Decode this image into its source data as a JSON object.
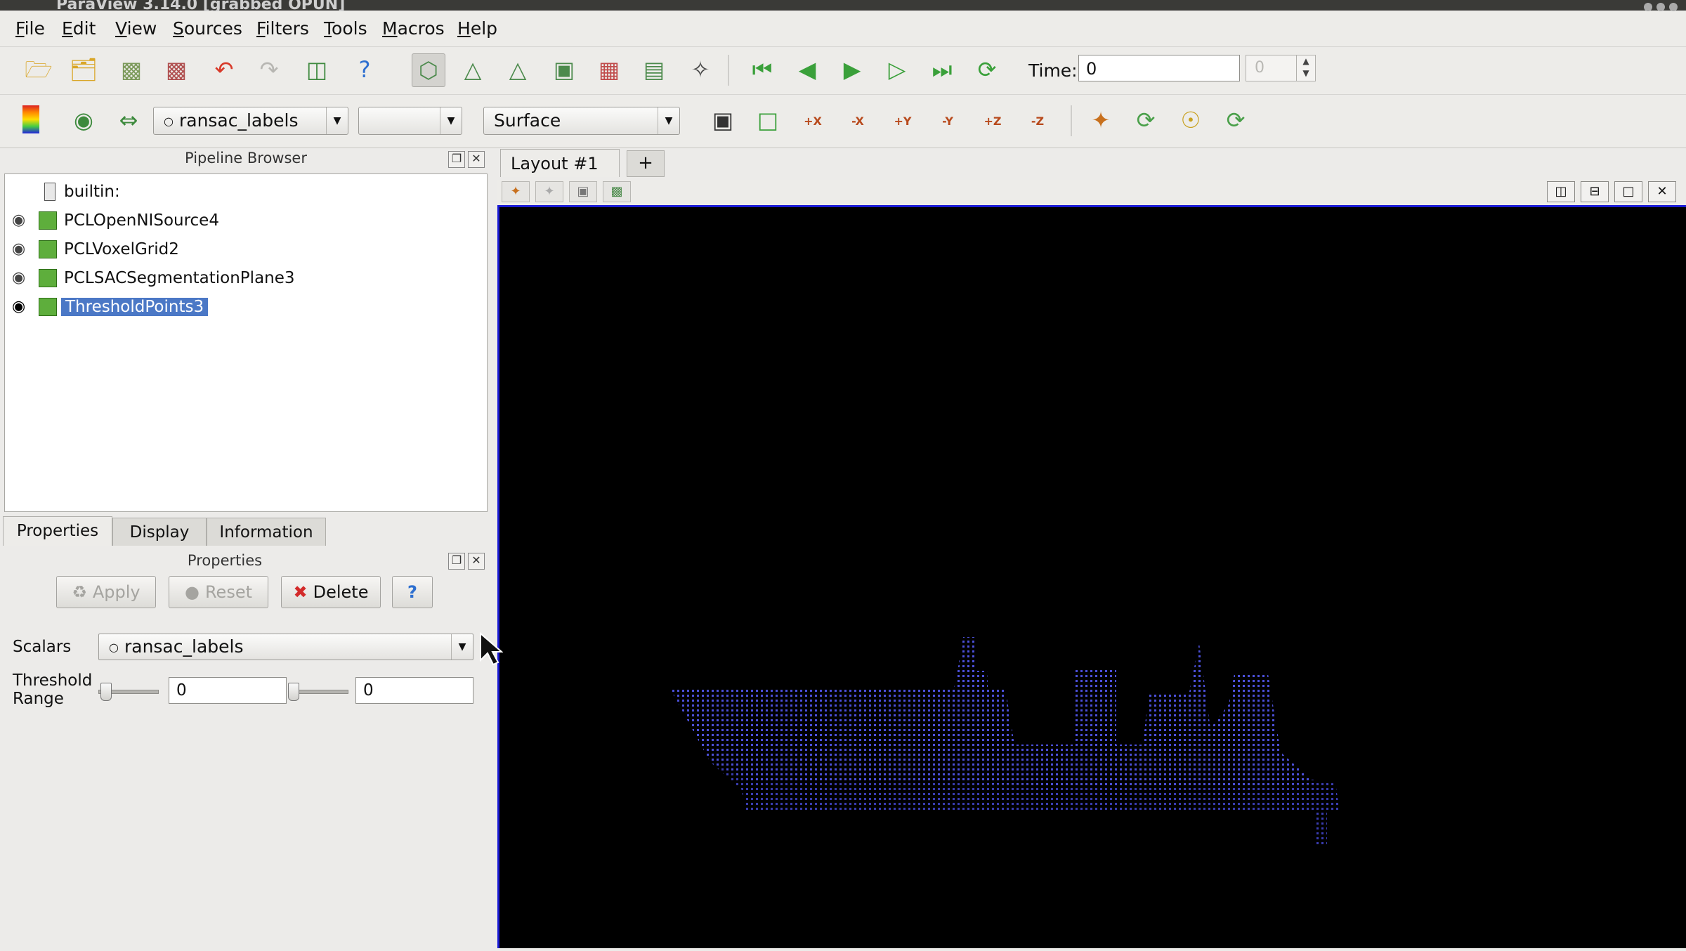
{
  "window": {
    "title": "ParaView 3.14.0 [grabbed OPUN]"
  },
  "menu": [
    "File",
    "Edit",
    "View",
    "Sources",
    "Filters",
    "Tools",
    "Macros",
    "Help"
  ],
  "toolbar": {
    "time_label": "Time:",
    "time_value": "0",
    "time_step": "0",
    "color_array": "ransac_labels",
    "component": "",
    "representation": "Surface",
    "camera_buttons": [
      "+X",
      "-X",
      "+Y",
      "-Y",
      "+Z",
      "-Z"
    ]
  },
  "pipeline": {
    "title": "Pipeline Browser",
    "items": [
      {
        "label": "builtin:",
        "visible": false,
        "selected": false
      },
      {
        "label": "PCLOpenNISource4",
        "visible": true,
        "selected": false
      },
      {
        "label": "PCLVoxelGrid2",
        "visible": true,
        "selected": false
      },
      {
        "label": "PCLSACSegmentationPlane3",
        "visible": true,
        "selected": false
      },
      {
        "label": "ThresholdPoints3",
        "visible": true,
        "selected": true
      }
    ]
  },
  "panel_tabs": [
    "Properties",
    "Display",
    "Information"
  ],
  "properties": {
    "title": "Properties",
    "apply": "Apply",
    "reset": "Reset",
    "delete": "Delete",
    "help": "?",
    "scalars_label": "Scalars",
    "scalars_value": "ransac_labels",
    "threshold_label_1": "Threshold",
    "threshold_label_2": "Range",
    "threshold_min": "0",
    "threshold_max": "0"
  },
  "layout": {
    "tab_label": "Layout #1",
    "close": "×",
    "add": "+"
  },
  "colors": {
    "viewport_bg": "#000000",
    "points": "#4b4fd8",
    "selection": "#4b78c6",
    "viewport_border": "#1a1ad6"
  }
}
